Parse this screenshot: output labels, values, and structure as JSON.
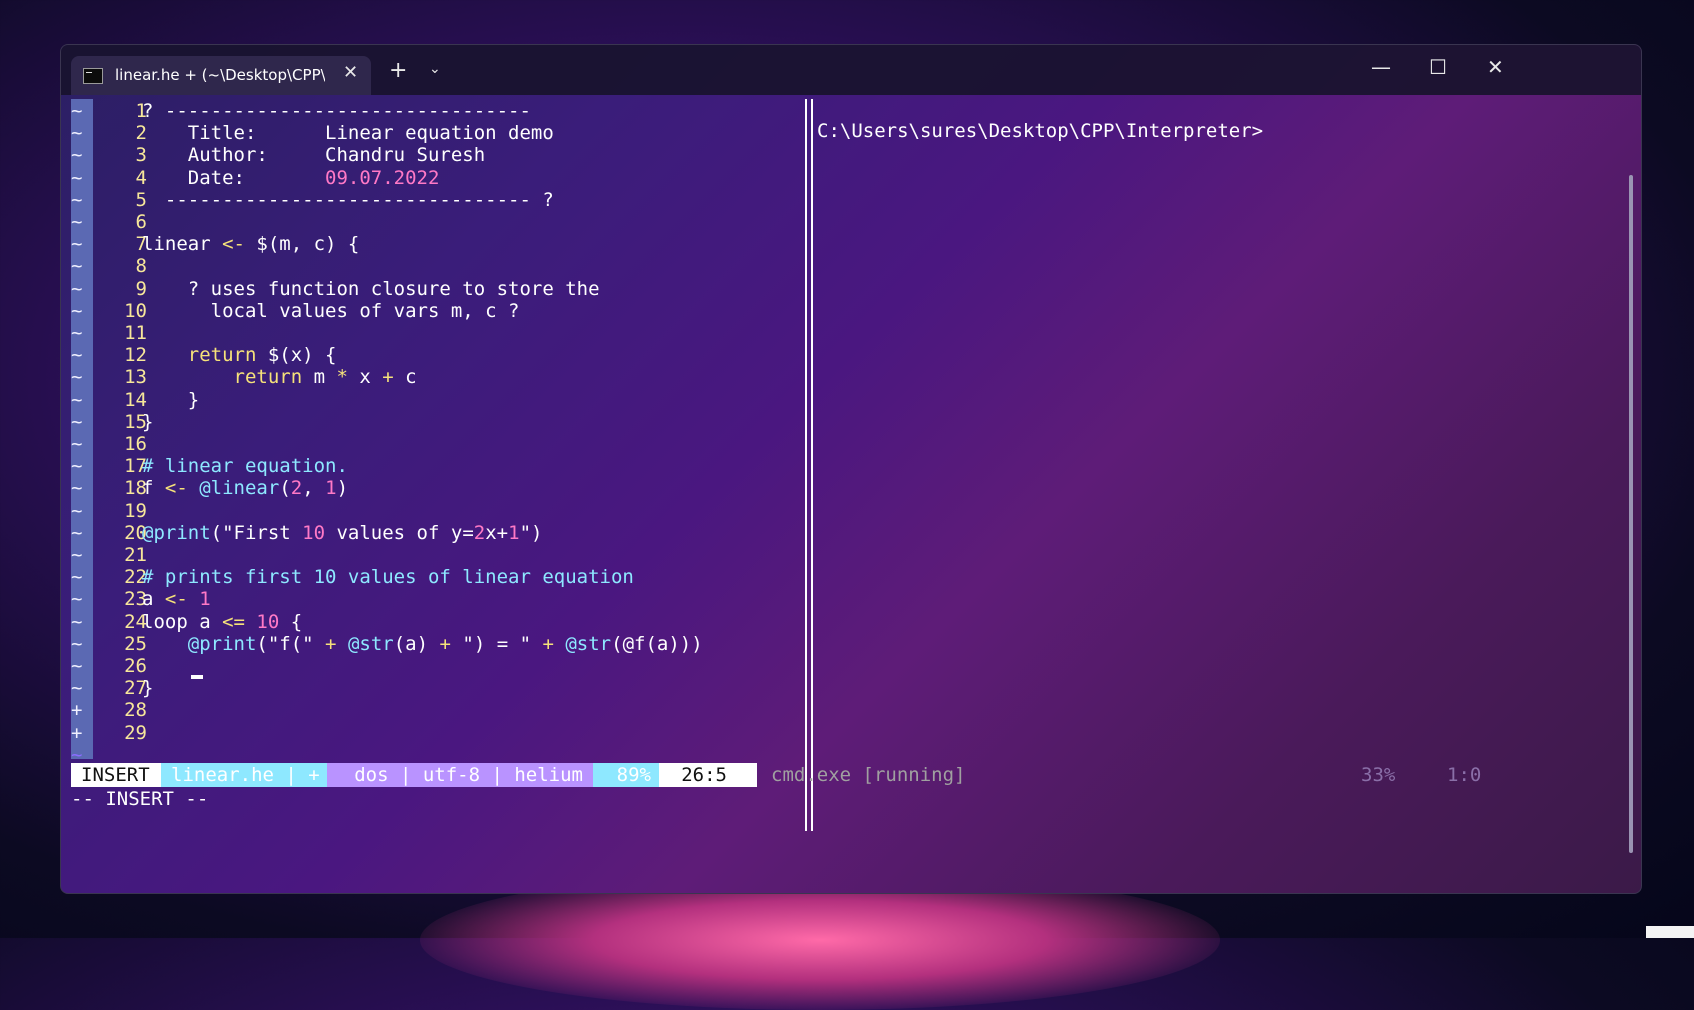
{
  "window": {
    "tab_title": "linear.he + (~\\Desktop\\CPP\\Interpreter)",
    "tab_close": "✕",
    "new_tab": "+",
    "dropdown": "⌄",
    "minimize": "—",
    "maximize": "☐",
    "close": "✕"
  },
  "editor": {
    "gutter_marks": [
      "~",
      "~",
      "~",
      "~",
      "~",
      "~",
      "~",
      "~",
      "~",
      "~",
      "~",
      "~",
      "~",
      "~",
      "~",
      "~",
      "~",
      "~",
      "~",
      "~",
      "~",
      "~",
      "~",
      "~",
      "~",
      "~",
      "~",
      "+",
      "+"
    ],
    "last_tilde": "~",
    "line_numbers": [
      "1",
      "2",
      "3",
      "4",
      "5",
      "6",
      "7",
      "8",
      "9",
      "10",
      "11",
      "12",
      "13",
      "14",
      "15",
      "16",
      "17",
      "18",
      "19",
      "20",
      "21",
      "22",
      "23",
      "24",
      "25",
      "26",
      "27",
      "28",
      "29"
    ],
    "lines": [
      [
        {
          "t": "? --------------------------------",
          "c": "fg"
        }
      ],
      [
        {
          "t": "    Title:      Linear equation demo",
          "c": "fg"
        }
      ],
      [
        {
          "t": "    Author:     Chandru Suresh",
          "c": "fg"
        }
      ],
      [
        {
          "t": "    Date:       ",
          "c": "fg"
        },
        {
          "t": "09.07.2022",
          "c": "num"
        }
      ],
      [
        {
          "t": "  -------------------------------- ?",
          "c": "fg"
        }
      ],
      [],
      [
        {
          "t": "linear ",
          "c": "fg"
        },
        {
          "t": "<-",
          "c": "kw"
        },
        {
          "t": " $(m, c) {",
          "c": "fg"
        }
      ],
      [],
      [
        {
          "t": "    ? uses function closure to store the",
          "c": "fg"
        }
      ],
      [
        {
          "t": "      local values of vars m, c ?",
          "c": "fg"
        }
      ],
      [],
      [
        {
          "t": "    ",
          "c": "fg"
        },
        {
          "t": "return",
          "c": "kw"
        },
        {
          "t": " $(x) {",
          "c": "fg"
        }
      ],
      [
        {
          "t": "        ",
          "c": "fg"
        },
        {
          "t": "return",
          "c": "kw"
        },
        {
          "t": " m ",
          "c": "fg"
        },
        {
          "t": "*",
          "c": "kw"
        },
        {
          "t": " x ",
          "c": "fg"
        },
        {
          "t": "+",
          "c": "kw"
        },
        {
          "t": " c",
          "c": "fg"
        }
      ],
      [
        {
          "t": "    }",
          "c": "fg"
        }
      ],
      [
        {
          "t": "}",
          "c": "fg"
        }
      ],
      [],
      [
        {
          "t": "# linear equation.",
          "c": "com"
        }
      ],
      [
        {
          "t": "f ",
          "c": "fg"
        },
        {
          "t": "<-",
          "c": "kw"
        },
        {
          "t": " ",
          "c": "fg"
        },
        {
          "t": "@linear",
          "c": "fn"
        },
        {
          "t": "(",
          "c": "fg"
        },
        {
          "t": "2",
          "c": "num"
        },
        {
          "t": ", ",
          "c": "fg"
        },
        {
          "t": "1",
          "c": "num"
        },
        {
          "t": ")",
          "c": "fg"
        }
      ],
      [],
      [
        {
          "t": "@print",
          "c": "fn"
        },
        {
          "t": "(\"First ",
          "c": "fg"
        },
        {
          "t": "10",
          "c": "num"
        },
        {
          "t": " values of y=",
          "c": "fg"
        },
        {
          "t": "2",
          "c": "num"
        },
        {
          "t": "x+",
          "c": "fg"
        },
        {
          "t": "1",
          "c": "num"
        },
        {
          "t": "\")",
          "c": "fg"
        }
      ],
      [],
      [
        {
          "t": "# prints first 10 values of linear equation",
          "c": "com"
        }
      ],
      [
        {
          "t": "a ",
          "c": "fg"
        },
        {
          "t": "<-",
          "c": "kw"
        },
        {
          "t": " ",
          "c": "fg"
        },
        {
          "t": "1",
          "c": "num"
        }
      ],
      [
        {
          "t": "loop a ",
          "c": "fg"
        },
        {
          "t": "<=",
          "c": "kw"
        },
        {
          "t": " ",
          "c": "fg"
        },
        {
          "t": "10",
          "c": "num"
        },
        {
          "t": " {",
          "c": "fg"
        }
      ],
      [
        {
          "t": "    ",
          "c": "fg"
        },
        {
          "t": "@print",
          "c": "fn"
        },
        {
          "t": "(\"f(\" ",
          "c": "fg"
        },
        {
          "t": "+",
          "c": "kw"
        },
        {
          "t": " ",
          "c": "fg"
        },
        {
          "t": "@str",
          "c": "fn"
        },
        {
          "t": "(a) ",
          "c": "fg"
        },
        {
          "t": "+",
          "c": "kw"
        },
        {
          "t": " \") = \" ",
          "c": "fg"
        },
        {
          "t": "+",
          "c": "kw"
        },
        {
          "t": " ",
          "c": "fg"
        },
        {
          "t": "@str",
          "c": "fn"
        },
        {
          "t": "(@f(a)))",
          "c": "fg"
        }
      ],
      [],
      [
        {
          "t": "}",
          "c": "fg"
        }
      ],
      [],
      []
    ]
  },
  "terminal": {
    "prompt": "C:\\Users\\sures\\Desktop\\CPP\\Interpreter>"
  },
  "statusline": {
    "mode": "INSERT",
    "file": "linear.he | +",
    "encoding": "dos | utf-8 | helium",
    "percent": "89%",
    "position": "26:5",
    "right_title": "cmd.exe [running]",
    "right_percent": "33%",
    "right_position": "1:0"
  },
  "cmdline": "-- INSERT --"
}
